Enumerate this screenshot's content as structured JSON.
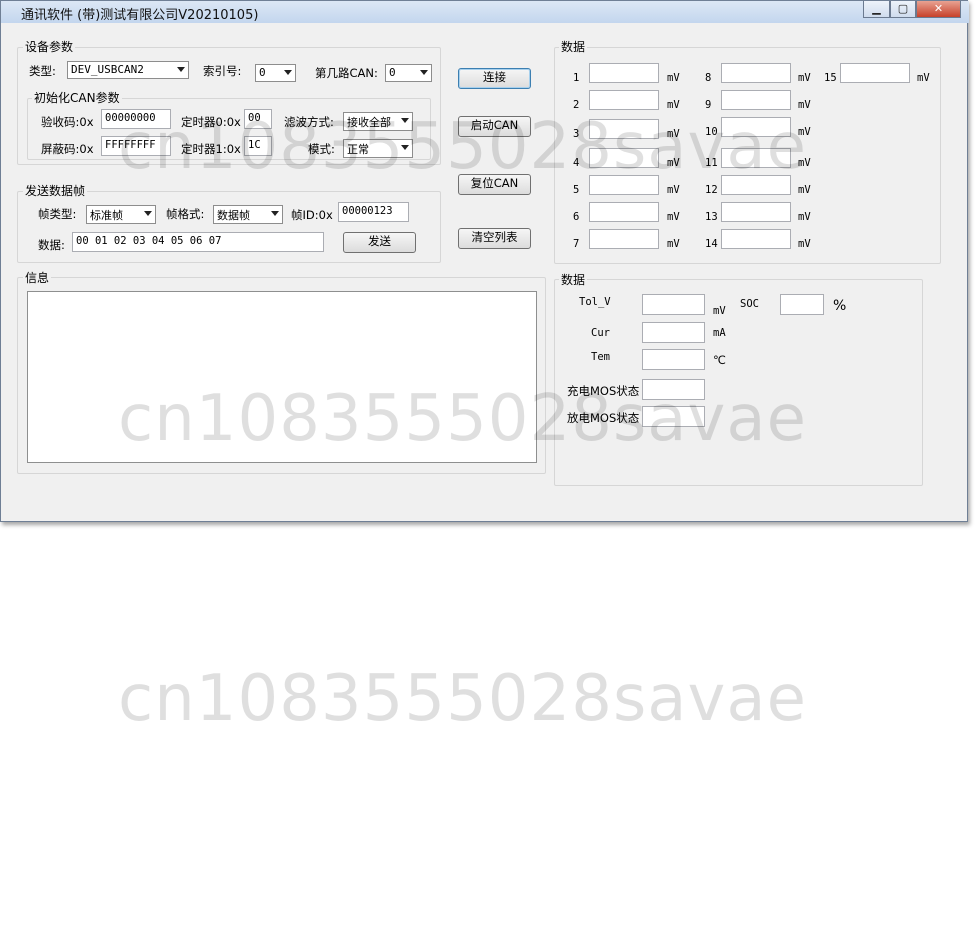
{
  "window": {
    "title": "通讯软件 (带)测试有限公司V20210105)",
    "buttons": {
      "minimize": "▁",
      "maximize": "▢",
      "close": "✕"
    }
  },
  "device": {
    "group_label": "设备参数",
    "type_label": "类型:",
    "type_value": "DEV_USBCAN2",
    "index_label": "索引号:",
    "index_value": "0",
    "can_label": "第几路CAN:",
    "can_value": "0",
    "init": {
      "group_label": "初始化CAN参数",
      "acc_code_label": "验收码:0x",
      "acc_code_value": "00000000",
      "timer0_label": "定时器0:0x",
      "timer0_value": "00",
      "filter_label": "滤波方式:",
      "filter_value": "接收全部",
      "mask_label": "屏蔽码:0x",
      "mask_value": "FFFFFFFF",
      "timer1_label": "定时器1:0x",
      "timer1_value": "1C",
      "mode_label": "模式:",
      "mode_value": "正常"
    }
  },
  "send": {
    "group_label": "发送数据帧",
    "frame_type_label": "帧类型:",
    "frame_type_value": "标准帧",
    "frame_format_label": "帧格式:",
    "frame_format_value": "数据帧",
    "frame_id_label": "帧ID:0x",
    "frame_id_value": "00000123",
    "data_label": "数据:",
    "data_value": "00 01 02 03 04 05 06 07",
    "send_button": "发送"
  },
  "actions": {
    "connect": "连接",
    "start_can": "启动CAN",
    "reset_can": "复位CAN",
    "clear_list": "清空列表"
  },
  "info": {
    "group_label": "信息"
  },
  "cells": {
    "group_label": "数据",
    "unit": "mV",
    "items": [
      {
        "index": "1",
        "value": ""
      },
      {
        "index": "2",
        "value": ""
      },
      {
        "index": "3",
        "value": ""
      },
      {
        "index": "4",
        "value": ""
      },
      {
        "index": "5",
        "value": ""
      },
      {
        "index": "6",
        "value": ""
      },
      {
        "index": "7",
        "value": ""
      },
      {
        "index": "8",
        "value": ""
      },
      {
        "index": "9",
        "value": ""
      },
      {
        "index": "10",
        "value": ""
      },
      {
        "index": "11",
        "value": ""
      },
      {
        "index": "12",
        "value": ""
      },
      {
        "index": "13",
        "value": ""
      },
      {
        "index": "14",
        "value": ""
      },
      {
        "index": "15",
        "value": ""
      }
    ]
  },
  "status": {
    "group_label": "数据",
    "tol_v_label": "Tol_V",
    "tol_v_unit": "mV",
    "tol_v_value": "",
    "soc_label": "SOC",
    "soc_unit": "%",
    "soc_value": "",
    "cur_label": "Cur",
    "cur_unit": "mA",
    "cur_value": "",
    "tem_label": "Tem",
    "tem_unit": "℃",
    "tem_value": "",
    "charge_mos_label": "充电MOS状态",
    "charge_mos_value": "",
    "discharge_mos_label": "放电MOS状态",
    "discharge_mos_value": ""
  },
  "watermark": "cn1083555028savae"
}
